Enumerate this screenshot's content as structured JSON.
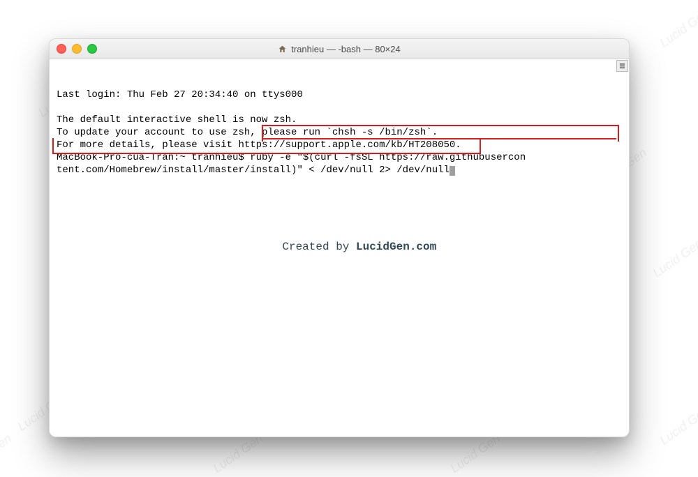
{
  "watermark_text": "Lucid Gen",
  "window": {
    "title": "tranhieu — -bash — 80×24"
  },
  "terminal": {
    "last_login": "Last login: Thu Feb 27 20:34:40 on ttys000",
    "msg1": "The default interactive shell is now zsh.",
    "msg2": "To update your account to use zsh, please run `chsh -s /bin/zsh`.",
    "msg3": "For more details, please visit https://support.apple.com/kb/HT208050.",
    "prompt": "MacBook-Pro-cua-Tran:~ tranhieu$ ",
    "cmd1": "ruby -e \"$(curl -fsSL https://raw.githubusercon",
    "cmd2": "tent.com/Homebrew/install/master/install)\" < /dev/null 2> /dev/null"
  },
  "credit": {
    "prefix": "Created by ",
    "site": "LucidGen.com"
  },
  "icons": {
    "home": "home-icon",
    "scroll": "scroll-indicator-icon"
  }
}
